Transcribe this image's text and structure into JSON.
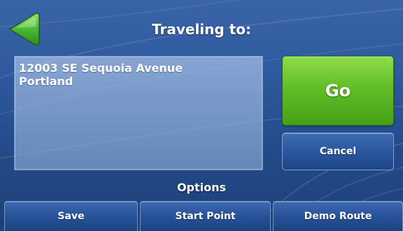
{
  "header": {
    "title": "Traveling to:"
  },
  "destination": {
    "line1": "12003 SE Sequoia Avenue",
    "line2": "Portland"
  },
  "actions": {
    "go_label": "Go",
    "cancel_label": "Cancel"
  },
  "options": {
    "label": "Options",
    "buttons": [
      {
        "label": "Save"
      },
      {
        "label": "Start Point"
      },
      {
        "label": "Demo Route"
      }
    ]
  },
  "colors": {
    "background": "#2f5a9f",
    "go_green": "#61be26",
    "back_arrow_green": "#3aaa2e",
    "button_blue": "#27529a"
  },
  "icons": {
    "back": "back-arrow-icon"
  }
}
